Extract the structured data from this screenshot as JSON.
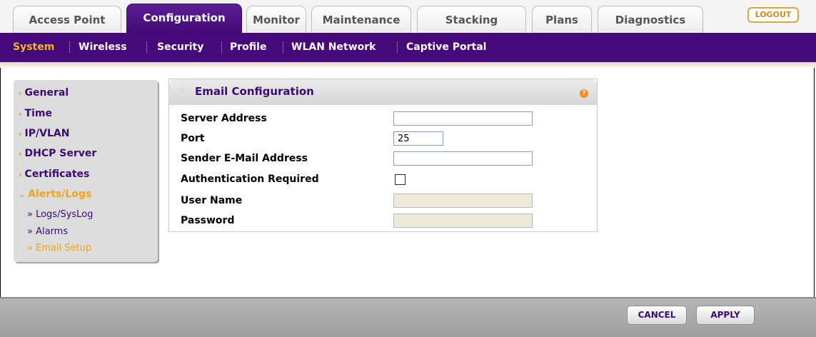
{
  "tabs": [
    {
      "label": "Access Point",
      "active": false
    },
    {
      "label": "Configuration",
      "active": true
    },
    {
      "label": "Monitor",
      "active": false
    },
    {
      "label": "Maintenance",
      "active": false
    },
    {
      "label": "Stacking",
      "active": false
    },
    {
      "label": "Plans",
      "active": false
    },
    {
      "label": "Diagnostics",
      "active": false
    }
  ],
  "logout_label": "LOGOUT",
  "submenu": [
    {
      "label": "System",
      "active": true
    },
    {
      "label": "Wireless",
      "active": false
    },
    {
      "label": "Security",
      "active": false
    },
    {
      "label": "Profile",
      "active": false
    },
    {
      "label": "WLAN Network",
      "active": false
    },
    {
      "label": "Captive Portal",
      "active": false
    }
  ],
  "sidebar": {
    "items": [
      {
        "label": "General",
        "active": false
      },
      {
        "label": "Time",
        "active": false
      },
      {
        "label": "IP/VLAN",
        "active": false
      },
      {
        "label": "DHCP Server",
        "active": false
      },
      {
        "label": "Certificates",
        "active": false
      },
      {
        "label": "Alerts/Logs",
        "active": true
      }
    ],
    "subitems": [
      {
        "label": "» Logs/SysLog",
        "active": false
      },
      {
        "label": "» Alarms",
        "active": false
      },
      {
        "label": "» Email Setup",
        "active": true
      }
    ]
  },
  "panel": {
    "title": "Email Configuration",
    "help_icon": "?",
    "fields": {
      "server_address": {
        "label": "Server Address",
        "value": ""
      },
      "port": {
        "label": "Port",
        "value": "25"
      },
      "sender_email": {
        "label": "Sender E-Mail Address",
        "value": ""
      },
      "auth_required": {
        "label": "Authentication Required",
        "checked": false
      },
      "user_name": {
        "label": "User Name",
        "value": "",
        "disabled": true
      },
      "password": {
        "label": "Password",
        "value": "",
        "disabled": true
      }
    }
  },
  "buttons": {
    "cancel": "CANCEL",
    "apply": "APPLY"
  },
  "colors": {
    "brand_purple": "#46097a",
    "accent_orange": "#f0a21c"
  }
}
